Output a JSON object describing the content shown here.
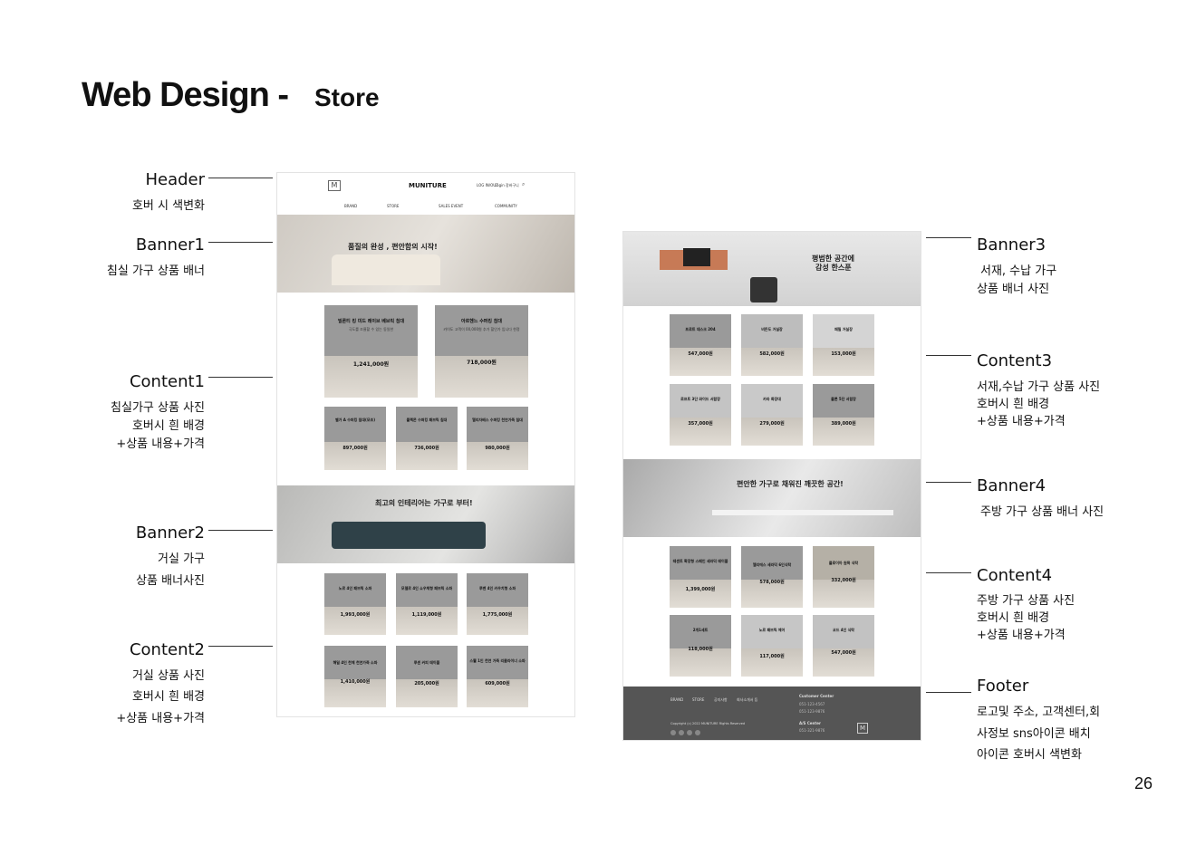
{
  "title": {
    "main": "Web Design -",
    "sub": "Store"
  },
  "page_number": "26",
  "left_labels": [
    {
      "label": "Header",
      "desc": [
        "호버 시 색변화"
      ]
    },
    {
      "label": "Banner1",
      "desc": [
        "침실 가구 상품 배너"
      ]
    },
    {
      "label": "Content1",
      "desc": [
        "침실가구 상품 사진",
        "호버시 흰 배경",
        "+상품 내용+가격"
      ]
    },
    {
      "label": "Banner2",
      "desc": [
        "거실 가구",
        "상품 배너사진"
      ]
    },
    {
      "label": "Content2",
      "desc": [
        "거실 상품 사진",
        "호버시 흰 배경",
        "+상품 내용+가격"
      ]
    }
  ],
  "right_labels": [
    {
      "label": "Banner3",
      "desc": [
        "서재, 수납 가구",
        "상품 배너 사진"
      ]
    },
    {
      "label": "Content3",
      "desc": [
        "서재,수납 가구 상품 사진",
        "호버시 흰 배경",
        "+상품 내용+가격"
      ]
    },
    {
      "label": "Banner4",
      "desc": [
        "주방 가구 상품 배너 사진"
      ]
    },
    {
      "label": "Content4",
      "desc": [
        "주방 가구 상품 사진",
        "호버시 흰 배경",
        "+상품 내용+가격"
      ]
    },
    {
      "label": "Footer",
      "desc": [
        "로고및 주소, 고객센터,회",
        "사정보 sns아이콘 배치",
        "아이콘 호버시 색변화"
      ]
    }
  ],
  "mock_left": {
    "logo": "M",
    "brand": "MUNITURE",
    "util": [
      "LOG IN/OUT",
      "Login",
      "장바구니"
    ],
    "nav": [
      "BRAND",
      "STORE",
      "SALES EVENT",
      "COMMUNITY"
    ],
    "banner1": "품질의 완성 , 편안함의 시작!",
    "content1_big": [
      {
        "name": "빌론티 킹 미드 레이브 베브릭 침대",
        "desc": "극도를 조율할 수 있는 동일한",
        "price": "1,241,000원"
      },
      {
        "name": "아르헨느 수퍼킹 침대",
        "desc": "카이도 고객이 00,000원 추가 할인가 입니다 한정",
        "price": "718,000원"
      }
    ],
    "content1_small": [
      {
        "name": "벨가 A 수퍼킹 침대(모조)",
        "price": "897,000원"
      },
      {
        "name": "플렉몬 수퍼킹 패브릭 침대",
        "price": "736,000원"
      },
      {
        "name": "엘리자베스 수퍼킹 천연가죽 침대",
        "price": "980,000원"
      }
    ],
    "banner2": "최고의 인테리어는 가구로 부터!",
    "content2": [
      {
        "name": "노르 4인 패브릭 소파",
        "price": "1,993,000원"
      },
      {
        "name": "모델르 4인 쇼우체형 패브릭 소파",
        "price": "1,119,000원"
      },
      {
        "name": "루벤 4인 카우치형 소파",
        "price": "1,775,000원"
      },
      {
        "name": "해밀 4인 천체 천연가죽 소파",
        "price": "1,410,000원"
      },
      {
        "name": "루센 커피 테이블",
        "price": "205,000원"
      },
      {
        "name": "스웰 1인 천연 가죽 리클라이너 소파",
        "price": "609,000원"
      }
    ]
  },
  "mock_right": {
    "banner3": [
      "평범한 공간에",
      "감성 한스푼"
    ],
    "content3": [
      {
        "name": "프로트 데스크 204",
        "price": "547,000원"
      },
      {
        "name": "비든도 거실장",
        "price": "582,000원"
      },
      {
        "name": "패밀 거실장",
        "price": "153,000원"
      },
      {
        "name": "로프트 3단 와이드 서랍장",
        "price": "357,000원"
      },
      {
        "name": "카라 화장대",
        "price": "279,000원"
      },
      {
        "name": "플론 5단 서랍장",
        "price": "389,000원"
      }
    ],
    "banner4": "편안한 가구로 채워진 깨끗한 공간!",
    "content4": [
      {
        "name": "테센트 확장형 스페인 세라믹 테이블",
        "price": "1,399,000원"
      },
      {
        "name": "엘리에스 세라믹 6인식탁",
        "price": "578,000원"
      },
      {
        "name": "플로이아 원목 식탁",
        "price": "332,000원"
      },
      {
        "name": "2개1세트",
        "price": "118,000원"
      },
      {
        "name": "노르 패브릭 체어",
        "price": "117,000원"
      },
      {
        "name": "코드 4인 식탁",
        "price": "547,000원"
      }
    ],
    "footer": {
      "links": [
        "BRAND",
        "STORE",
        "공지사항",
        "회사소개서 등"
      ],
      "cc_title": "Customer Center",
      "cc_phone1": "051-123-4567",
      "cc_phone2": "051-123-9876",
      "as_title": "A/S Center",
      "as_phone": "051-321-9876",
      "copyright": "Copyright (c) 2022 MUNITURE Rights Reserved",
      "logo": "M"
    }
  }
}
